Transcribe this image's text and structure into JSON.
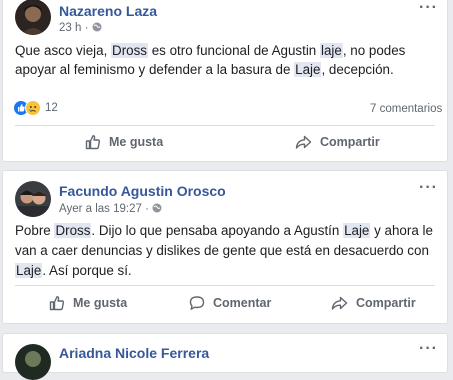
{
  "posts": [
    {
      "author": "Nazareno Laza",
      "time": "23 h",
      "text_parts": [
        "Que asco vieja, ",
        "Dross",
        " es otro funcional de Agustin ",
        "laje",
        ", no podes apoyar al feminismo y defender a la basura de ",
        "Laje",
        ", decepción."
      ],
      "reactions_count": "12",
      "comments_count": "7 comentarios",
      "actions": {
        "like": "Me gusta",
        "share": "Compartir"
      }
    },
    {
      "author": "Facundo Agustin Orosco",
      "time": "Ayer a las 19:27",
      "text_parts": [
        "Pobre ",
        "Dross",
        ". Dijo lo que pensaba apoyando a Agustín ",
        "Laje",
        " y ahora le van a caer denuncias y dislikes de gente que está en desacuerdo con ",
        "Laje",
        ". Así porque sí."
      ],
      "actions": {
        "like": "Me gusta",
        "comment": "Comentar",
        "share": "Compartir"
      }
    },
    {
      "author": "Ariadna Nicole Ferrera"
    }
  ],
  "colors": {
    "link": "#365899",
    "like_blue": "#1877f2",
    "background": "#e9ebee"
  },
  "icons": [
    "globe-icon",
    "more-options-icon",
    "like-reaction-icon",
    "sad-reaction-icon",
    "thumbs-up-icon",
    "comment-icon",
    "share-icon"
  ]
}
